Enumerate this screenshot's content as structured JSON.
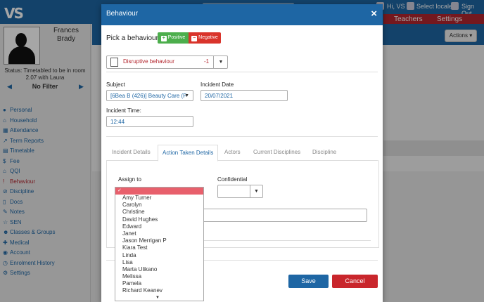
{
  "app": {
    "logo": "VS",
    "top_greeting": "Hi, VS",
    "top_locale": "Select locale",
    "top_signout": "Sign Out",
    "nav_teachers": "Teachers",
    "nav_settings": "Settings",
    "actions_label": "Actions ▾"
  },
  "student": {
    "first_name": "Frances",
    "last_name": "Brady",
    "status": "Status: Timetabled to be in room 2.07 with Laura",
    "filter": "No Filter"
  },
  "sidebar": {
    "items": [
      {
        "label": "Personal",
        "icon": "user-icon"
      },
      {
        "label": "Household",
        "icon": "home-icon"
      },
      {
        "label": "Attendance",
        "icon": "calendar-icon"
      },
      {
        "label": "Term Reports",
        "icon": "chart-icon"
      },
      {
        "label": "Timetable",
        "icon": "table-icon"
      },
      {
        "label": "Fee",
        "icon": "dollar-icon"
      },
      {
        "label": "QQI",
        "icon": "bank-icon"
      },
      {
        "label": "Behaviour",
        "icon": "exclamation-icon",
        "active": true
      },
      {
        "label": "Discipline",
        "icon": "ban-icon"
      },
      {
        "label": "Docs",
        "icon": "file-icon"
      },
      {
        "label": "Notes",
        "icon": "edit-icon"
      },
      {
        "label": "SEN",
        "icon": "star-icon"
      },
      {
        "label": "Classes & Groups",
        "icon": "users-icon"
      },
      {
        "label": "Medical",
        "icon": "medkit-icon"
      },
      {
        "label": "Account",
        "icon": "account-icon"
      },
      {
        "label": "Enrolment History",
        "icon": "history-icon"
      },
      {
        "label": "Settings",
        "icon": "gear-icon"
      }
    ]
  },
  "modal": {
    "title": "Behaviour",
    "close": "×",
    "pick_label": "Pick a behaviour",
    "positive_label": "Positive",
    "negative_label": "Negative",
    "behaviour_value": "Disruptive behaviour",
    "behaviour_points": "-1",
    "subject_label": "Subject",
    "subject_value": "[6Bea B (426)] Beauty Care (F",
    "incident_date_label": "Incident Date",
    "incident_date_value": "20/07/2021",
    "incident_time_label": "Incident Time:",
    "incident_time_value": "12:44",
    "tabs": [
      "Incident Details",
      "Action Taken Details",
      "Actors",
      "Current Disciplines",
      "Discipline"
    ],
    "active_tab": 1,
    "assign_label": "Assign to",
    "confidential_label": "Confidential",
    "save_label": "Save",
    "cancel_label": "Cancel"
  },
  "assign_dropdown": {
    "selected_marker": "✓",
    "options": [
      "Amy Turner",
      "Carolyn",
      "Christine",
      "David Hughes",
      "Edward",
      "Janet",
      "Jason Merrigan P",
      "Kiara Test",
      "Linda",
      "Lisa",
      "Marta Ulikano",
      "Melissa",
      "Pamela",
      "Richard Keanev"
    ],
    "more_indicator": "▼"
  },
  "colors": {
    "primary": "#1e66a4",
    "danger": "#c9262c",
    "success": "#4cae4c",
    "highlight": "#e8606c"
  }
}
